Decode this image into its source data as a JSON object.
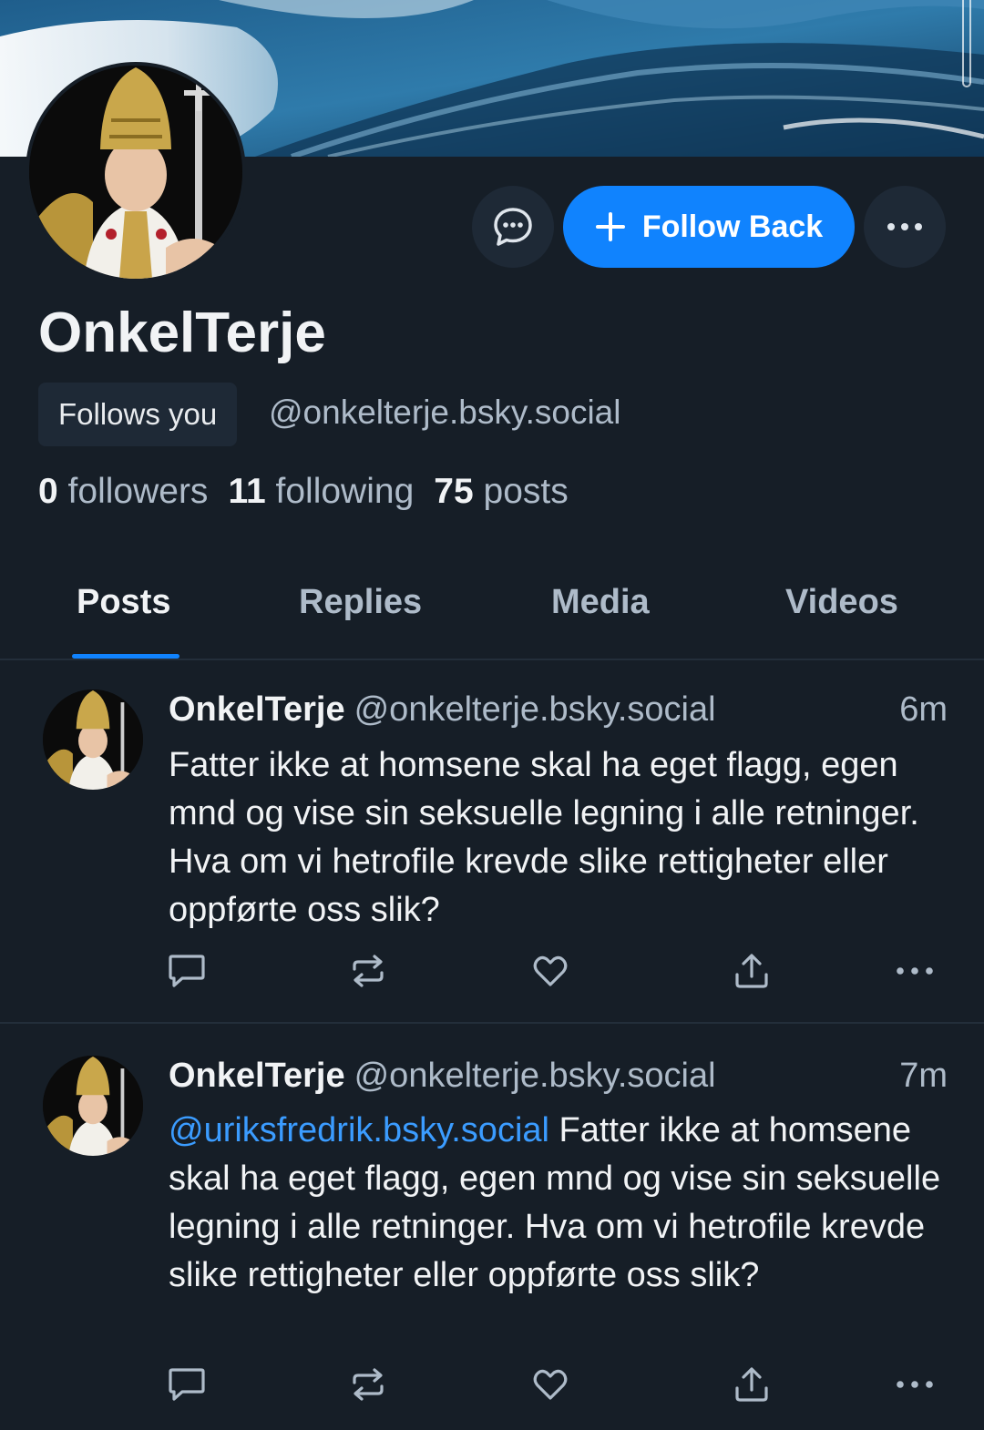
{
  "profile": {
    "display_name": "OnkelTerje",
    "follows_you": "Follows you",
    "handle": "@onkelterje.bsky.social",
    "followers_count": "0",
    "followers_label": "followers",
    "following_count": "11",
    "following_label": "following",
    "posts_count": "75",
    "posts_label": "posts"
  },
  "actions": {
    "follow_label": "Follow Back",
    "message_icon": "chat-bubble-icon",
    "more_icon": "ellipsis-icon"
  },
  "tabs": [
    {
      "label": "Posts",
      "active": true
    },
    {
      "label": "Replies",
      "active": false
    },
    {
      "label": "Media",
      "active": false
    },
    {
      "label": "Videos",
      "active": false
    }
  ],
  "posts": [
    {
      "name": "OnkelTerje",
      "handle": "@onkelterje.bsky.social",
      "time": "6m",
      "mention": "",
      "text": "Fatter ikke at homsene skal ha eget flagg, egen mnd og vise sin seksuelle legning i alle retninger. Hva om vi hetrofile krevde slike rettigheter eller oppførte oss slik?"
    },
    {
      "name": "OnkelTerje",
      "handle": "@onkelterje.bsky.social",
      "time": "7m",
      "mention": "@uriksfredrik.bsky.social",
      "text": " Fatter ikke at homsene skal ha eget flagg, egen mnd og vise sin seksuelle legning i alle retninger. Hva om vi hetrofile krevde slike rettigheter eller oppførte oss slik?"
    }
  ],
  "colors": {
    "background": "#161e27",
    "accent": "#1083fe",
    "muted_text": "#aebbc9",
    "mention": "#3b9cff"
  }
}
